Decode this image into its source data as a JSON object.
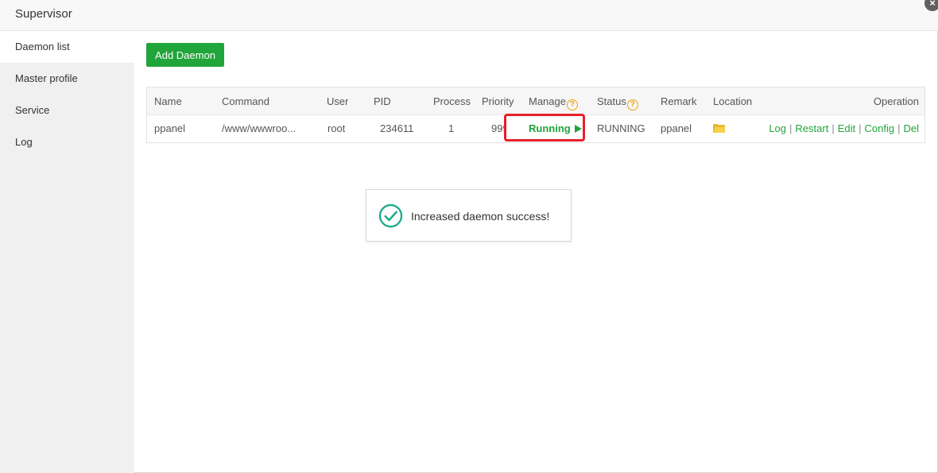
{
  "window": {
    "title": "Supervisor",
    "close_label": "×"
  },
  "sidebar": {
    "items": [
      {
        "label": "Daemon list",
        "active": true
      },
      {
        "label": "Master profile"
      },
      {
        "label": "Service"
      },
      {
        "label": "Log"
      }
    ]
  },
  "toolbar": {
    "add_label": "Add Daemon"
  },
  "table": {
    "headers": {
      "name": "Name",
      "command": "Command",
      "user": "User",
      "pid": "PID",
      "process": "Process",
      "priority": "Priority",
      "manage": "Manage",
      "status": "Status",
      "remark": "Remark",
      "location": "Location",
      "operation": "Operation"
    },
    "help_glyph": "?",
    "rows": [
      {
        "name": "ppanel",
        "command": "/www/wwwroo...",
        "user": "root",
        "pid": "234611",
        "process": "1",
        "priority": "999",
        "manage": "Running",
        "status": "RUNNING",
        "remark": "ppanel",
        "location_icon": "folder-open-icon",
        "operations": [
          "Log",
          "Restart",
          "Edit",
          "Config",
          "Del"
        ]
      }
    ]
  },
  "toast": {
    "message": "Increased daemon success!",
    "icon": "check-circle-icon"
  },
  "colors": {
    "accent": "#20a53a",
    "highlight": "#e8202a",
    "help": "#f0a30a",
    "folder": "#e9b92e"
  }
}
